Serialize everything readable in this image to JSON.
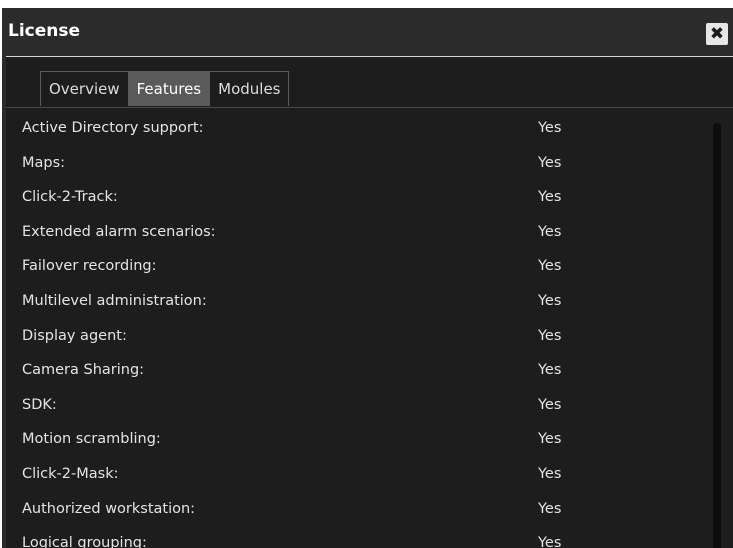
{
  "dialog": {
    "title": "License",
    "close_icon": "close-icon",
    "close_glyph": "✖"
  },
  "tabs": [
    {
      "label": "Overview",
      "active": false
    },
    {
      "label": "Features",
      "active": true
    },
    {
      "label": "Modules",
      "active": false
    }
  ],
  "features": [
    {
      "label": "Active Directory support:",
      "value": "Yes"
    },
    {
      "label": "Maps:",
      "value": "Yes"
    },
    {
      "label": "Click-2-Track:",
      "value": "Yes"
    },
    {
      "label": "Extended alarm scenarios:",
      "value": "Yes"
    },
    {
      "label": "Failover recording:",
      "value": "Yes"
    },
    {
      "label": "Multilevel administration:",
      "value": "Yes"
    },
    {
      "label": "Display agent:",
      "value": "Yes"
    },
    {
      "label": "Camera Sharing:",
      "value": "Yes"
    },
    {
      "label": "SDK:",
      "value": "Yes"
    },
    {
      "label": "Motion scrambling:",
      "value": "Yes"
    },
    {
      "label": "Click-2-Mask:",
      "value": "Yes"
    },
    {
      "label": "Authorized workstation:",
      "value": "Yes"
    },
    {
      "label": "Logical grouping:",
      "value": "Yes"
    }
  ],
  "colors": {
    "title_background": "#2b2b2b",
    "content_background": "#1d1d1d",
    "active_tab": "#5a5a5a",
    "text": "#e4e4e4"
  }
}
